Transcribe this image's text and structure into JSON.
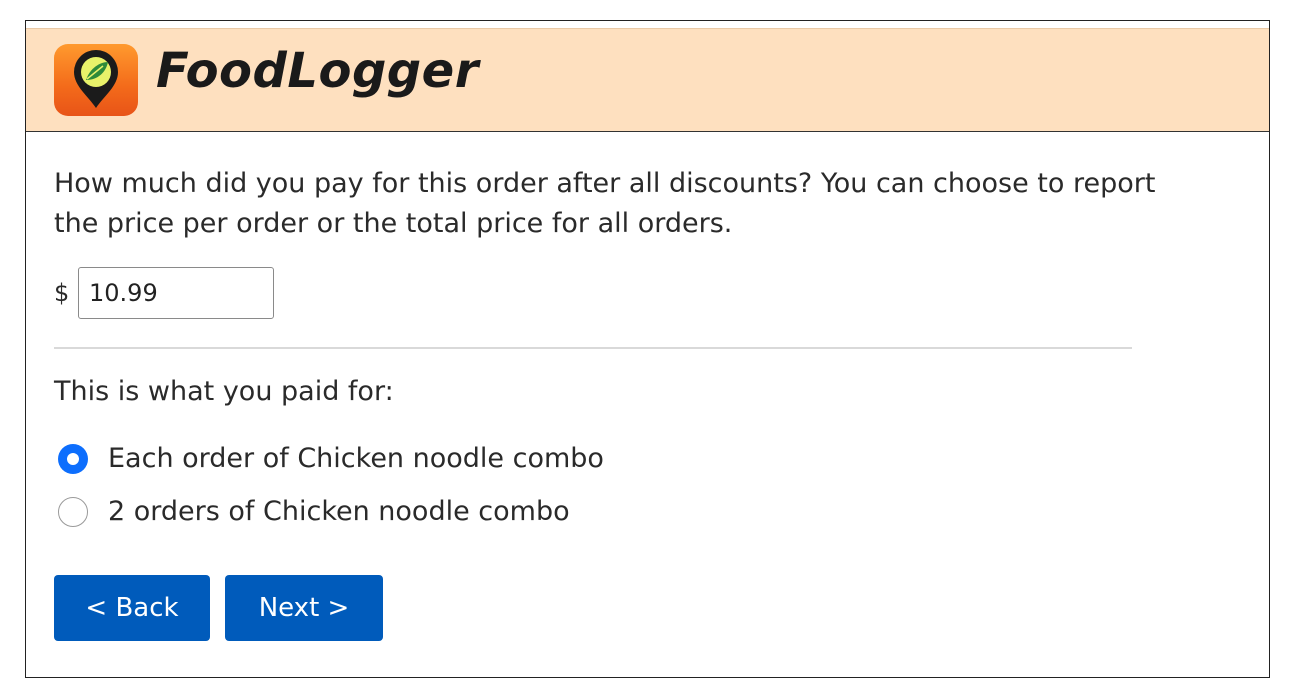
{
  "app": {
    "title": "FoodLogger"
  },
  "question": {
    "text": "How much did you pay for this order after all discounts? You can choose to report the price per order or the total price for all orders."
  },
  "price": {
    "currency_symbol": "$",
    "value": "10.99"
  },
  "paid_for": {
    "label": "This is what you paid for:",
    "options": [
      {
        "label": "Each order of Chicken noodle combo",
        "selected": true
      },
      {
        "label": "2 orders of Chicken noodle combo",
        "selected": false
      }
    ]
  },
  "nav": {
    "back_label": "< Back",
    "next_label": "Next >"
  },
  "colors": {
    "header_bg": "#fee0bf",
    "button_bg": "#005bbb",
    "radio_accent": "#0d6efd",
    "logo_orange": "#f36a1a"
  }
}
